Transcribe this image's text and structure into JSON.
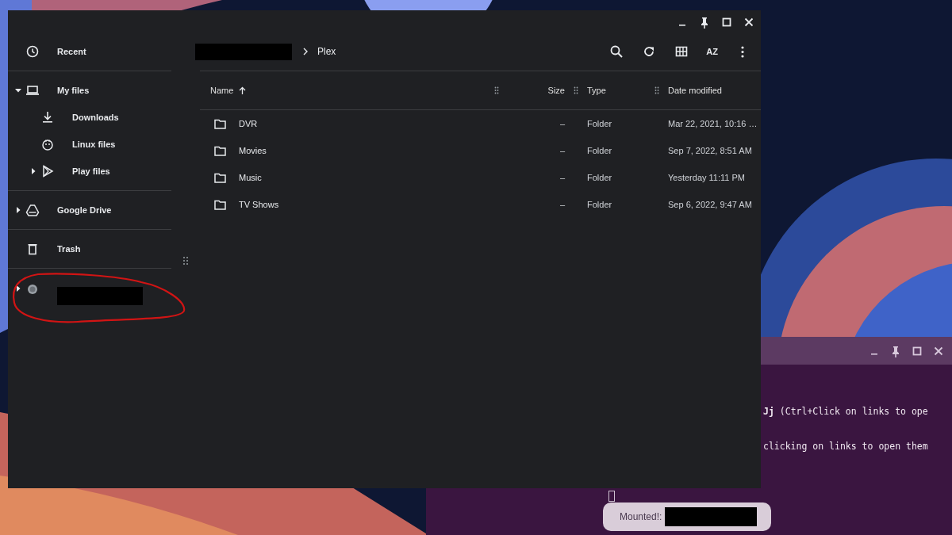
{
  "files_window": {
    "breadcrumb": [
      {
        "kind": "redacted"
      },
      {
        "kind": "text",
        "label": "Plex"
      }
    ],
    "toolbar": [
      {
        "kind": "search"
      },
      {
        "kind": "refresh"
      },
      {
        "kind": "grid"
      },
      {
        "kind": "sort",
        "label": "AZ"
      },
      {
        "kind": "more"
      }
    ],
    "sidebar": {
      "sections": [
        [
          {
            "kind": "recent",
            "label": "Recent",
            "expandable": false
          }
        ],
        [
          {
            "kind": "my_files",
            "label": "My files",
            "expandable": true,
            "expanded": true,
            "children": [
              {
                "kind": "downloads",
                "label": "Downloads",
                "expandable": false
              },
              {
                "kind": "linux",
                "label": "Linux files",
                "expandable": false
              },
              {
                "kind": "play",
                "label": "Play files",
                "expandable": true,
                "expanded": false
              }
            ]
          }
        ],
        [
          {
            "kind": "drive",
            "label": "Google Drive",
            "expandable": true,
            "expanded": false
          }
        ],
        [
          {
            "kind": "trash",
            "label": "Trash",
            "expandable": false
          }
        ],
        [
          {
            "kind": "volume",
            "redacted": true,
            "expandable": true,
            "expanded": false,
            "circled": true
          }
        ]
      ]
    },
    "table": {
      "columns": [
        {
          "label": "Name",
          "sorted": true
        },
        {
          "label": "Size",
          "sorted": false
        },
        {
          "label": "Type",
          "sorted": false
        },
        {
          "label": "Date modified",
          "sorted": false
        }
      ],
      "rows": [
        {
          "name": "DVR",
          "size": "–",
          "type": "Folder",
          "modified": "Mar 22, 2021, 10:16 …"
        },
        {
          "name": "Movies",
          "size": "–",
          "type": "Folder",
          "modified": "Sep 7, 2022, 8:51 AM"
        },
        {
          "name": "Music",
          "size": "–",
          "type": "Folder",
          "modified": "Yesterday 11:11 PM"
        },
        {
          "name": "TV Shows",
          "size": "–",
          "type": "Folder",
          "modified": "Sep 6, 2022, 9:47 AM"
        }
      ]
    }
  },
  "terminal": {
    "lines": [
      "**Jj** (Ctrl+Click on links to ope",
      "clicking on links to open them"
    ]
  },
  "toast": {
    "label": "Mounted!:",
    "redacted": true
  }
}
